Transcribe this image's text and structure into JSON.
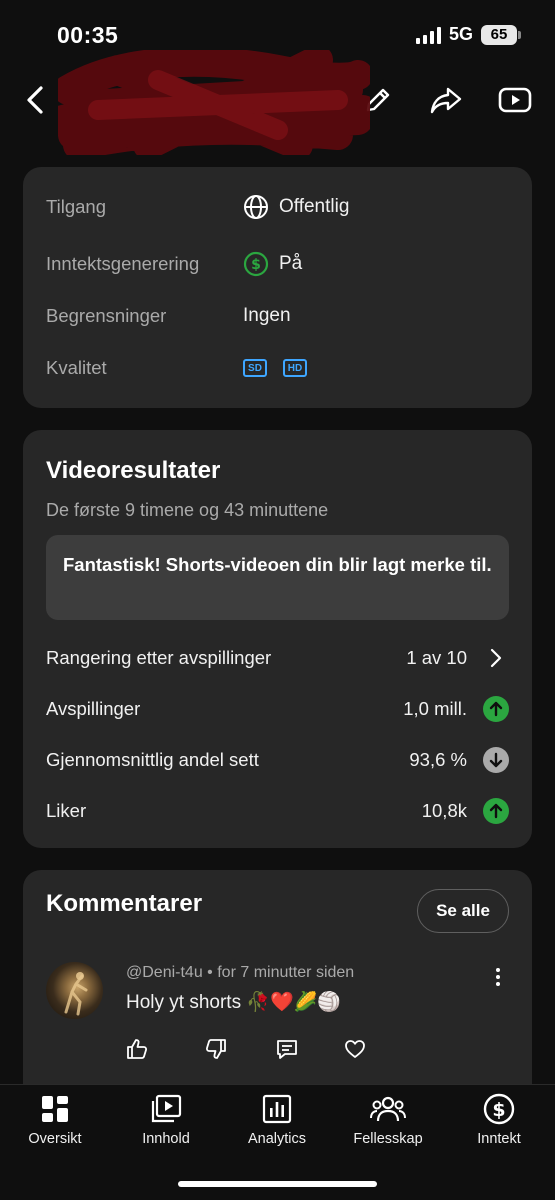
{
  "status_bar": {
    "time": "00:35",
    "network": "5G",
    "battery": "65"
  },
  "info": {
    "rows": [
      {
        "label": "Tilgang",
        "value": "Offentlig"
      },
      {
        "label": "Inntektsgenerering",
        "value": "På"
      },
      {
        "label": "Begrensninger",
        "value": "Ingen"
      },
      {
        "label": "Kvalitet",
        "badges": [
          "SD",
          "HD"
        ]
      }
    ]
  },
  "results": {
    "title": "Videoresultater",
    "subtitle": "De første 9 timene og 43 minuttene",
    "notice": "Fantastisk! Shorts-videoen din blir lagt merke til.",
    "metrics": [
      {
        "label": "Rangering etter avspillinger",
        "value": "1 av 10",
        "indicator": "chevron-right"
      },
      {
        "label": "Avspillinger",
        "value": "1,0 mill.",
        "indicator": "up",
        "color": "#2ba640"
      },
      {
        "label": "Gjennomsnittlig andel sett",
        "value": "93,6 %",
        "indicator": "down",
        "color": "#aaaaaa"
      },
      {
        "label": "Liker",
        "value": "10,8k",
        "indicator": "up",
        "color": "#2ba640"
      }
    ]
  },
  "comments": {
    "title": "Kommentarer",
    "see_all": "Se alle",
    "item": {
      "author": "@Deni-t4u",
      "time": "for 7 minutter siden",
      "separator": "•",
      "text": "Holy yt shorts 🥀❤️🌽🏐"
    }
  },
  "nav": [
    {
      "label": "Oversikt",
      "icon": "dashboard-icon"
    },
    {
      "label": "Innhold",
      "icon": "content-icon"
    },
    {
      "label": "Analytics",
      "icon": "analytics-icon"
    },
    {
      "label": "Fellesskap",
      "icon": "community-icon"
    },
    {
      "label": "Inntekt",
      "icon": "earn-icon"
    }
  ],
  "colors": {
    "background": "#0f0f0f",
    "card": "#272727",
    "accent_blue": "#3ea6ff",
    "up_green": "#2ba640"
  }
}
